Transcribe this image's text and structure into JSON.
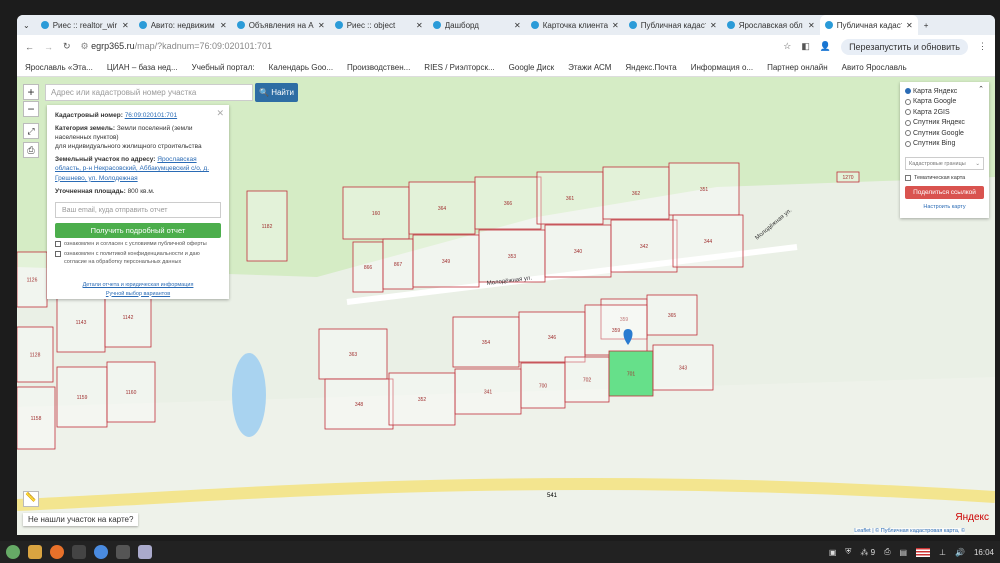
{
  "browser": {
    "tabs": [
      "Риес :: realtor_wir",
      "Авито: недвижим",
      "Объявления на А",
      "Риес :: object",
      "Дашборд",
      "Карточка клиента",
      "Публичная кадаст",
      "Ярославская обл",
      "Публичная кадаст"
    ],
    "active_tab": 8,
    "url_host": "egrp365.ru",
    "url_path": "/map/?kadnum=76:09:020101:701",
    "restart_label": "Перезапустить и обновить",
    "bookmarks": [
      "Ярославль «Эта...",
      "ЦИАН – база нед...",
      "Учебный портал:",
      "Календарь Goo...",
      "Производствен...",
      "RIES / Риэлторск...",
      "Google Диск",
      "Этажи АСМ",
      "Яндекс.Почта",
      "Информация о...",
      "Партнер онлайн",
      "Авито Ярославль"
    ]
  },
  "map": {
    "search_placeholder": "Адрес или кадастровый номер участка",
    "find_label": "Найти",
    "popup": {
      "cad_label": "Кадастровый номер:",
      "cad_value": "76:09:020101:701",
      "cat_label": "Категория земель:",
      "cat_value": "Земли поселений (земли населенных пунктов)",
      "use_value": "для индивидуального жилищного строительства",
      "addr_label": "Земельный участок по адресу:",
      "addr_value": "Ярославская область, р-н Некрасовский, Аббакумцевский с/о, д. Грешнево, ул. Молодежная",
      "area_label": "Уточненная площадь:",
      "area_value": "800 кв.м.",
      "email_placeholder": "Ваш email, куда отправить отчет",
      "get_report": "Получить подробный отчет",
      "check1": "ознакомлен и согласен с условиями публичной оферты",
      "check2": "ознакомлен с политикой конфиденциальности и даю согласие на обработку персональных данных",
      "link1": "Детали отчета и юридическая информация",
      "link2": "Ручной выбор вариантов"
    },
    "layers": {
      "options": [
        "Карта Яндекс",
        "Карта Google",
        "Карта 2GIS",
        "Спутник Яндекс",
        "Спутник Google",
        "Спутник Bing"
      ],
      "selected": 0,
      "select_value": "Кадастровые границы",
      "thematic": "Тематическая карта",
      "share": "Поделиться ссылкой",
      "configure": "Настроить карту"
    },
    "street": "Молодёжная ул.",
    "road": "541",
    "parcels": [
      "160",
      "364",
      "366",
      "361",
      "362",
      "351",
      "866",
      "867",
      "349",
      "353",
      "340",
      "342",
      "344",
      "359",
      "365",
      "354",
      "346",
      "359",
      "363",
      "341",
      "700",
      "702",
      "701",
      "343",
      "348",
      "352",
      "1182",
      "1126",
      "1143",
      "1142",
      "1128",
      "1159",
      "1160",
      "1158",
      "1270"
    ],
    "not_found": "Не нашли участок на карте?",
    "attribution": "Leaflet | © Публичная кадастровая карта, ©",
    "yandex": "Яндекс",
    "selected_color": "#66e08a"
  },
  "taskbar": {
    "time": "16:04",
    "wifi_count": "9"
  }
}
